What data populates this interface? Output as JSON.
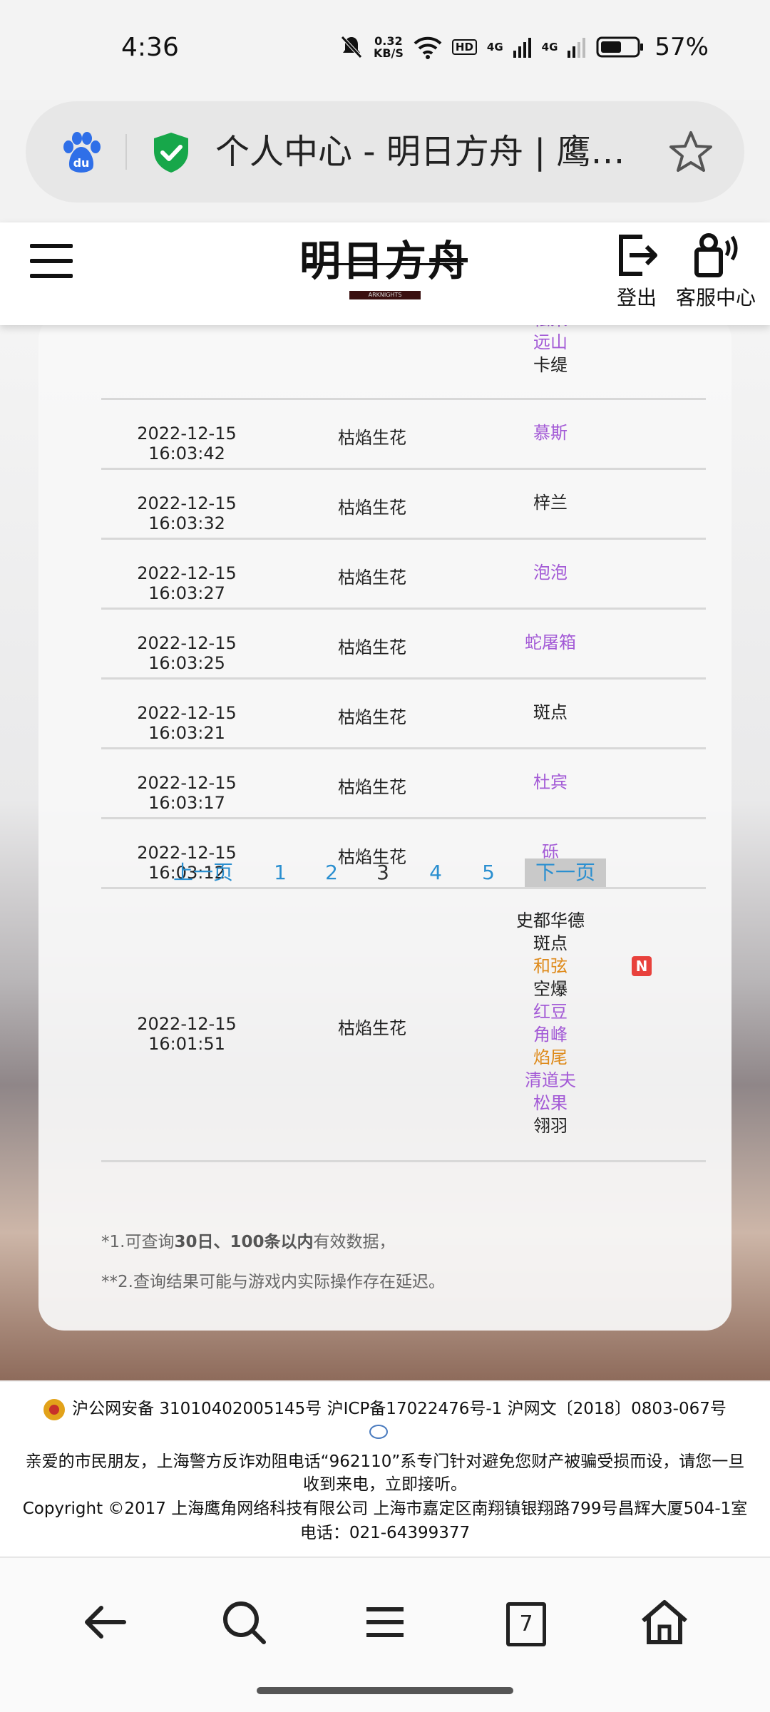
{
  "status_bar": {
    "time": "4:36",
    "net_speed_value": "0.32",
    "net_speed_unit": "KB/S",
    "hd_label": "HD",
    "sig1": "4G",
    "sig2": "4G",
    "battery": "57%"
  },
  "browser": {
    "page_title": "个人中心 - 明日方舟 | 鹰…"
  },
  "site_header": {
    "logo_text": "明日方舟",
    "logo_sub": "ARKNIGHTS",
    "logout_label": "登出",
    "service_label": "客服中心"
  },
  "records": [
    {
      "time": "",
      "item": "",
      "operators": [
        {
          "name": "松果",
          "color": "purple"
        },
        {
          "name": "远山",
          "color": "purple"
        },
        {
          "name": "卡缇",
          "color": "black"
        }
      ]
    },
    {
      "time": "2022-12-15 16:03:42",
      "item": "枯焰生花",
      "operators": [
        {
          "name": "慕斯",
          "color": "purple"
        }
      ]
    },
    {
      "time": "2022-12-15 16:03:32",
      "item": "枯焰生花",
      "operators": [
        {
          "name": "梓兰",
          "color": "black"
        }
      ]
    },
    {
      "time": "2022-12-15 16:03:27",
      "item": "枯焰生花",
      "operators": [
        {
          "name": "泡泡",
          "color": "purple"
        }
      ]
    },
    {
      "time": "2022-12-15 16:03:25",
      "item": "枯焰生花",
      "operators": [
        {
          "name": "蛇屠箱",
          "color": "purple"
        }
      ]
    },
    {
      "time": "2022-12-15 16:03:21",
      "item": "枯焰生花",
      "operators": [
        {
          "name": "斑点",
          "color": "black"
        }
      ]
    },
    {
      "time": "2022-12-15 16:03:17",
      "item": "枯焰生花",
      "operators": [
        {
          "name": "杜宾",
          "color": "purple"
        }
      ]
    },
    {
      "time": "2022-12-15 16:03:12",
      "item": "枯焰生花",
      "operators": [
        {
          "name": "砾",
          "color": "purple"
        }
      ]
    },
    {
      "time": "2022-12-15 16:01:51",
      "item": "枯焰生花",
      "new_badge": "N",
      "operators": [
        {
          "name": "史都华德",
          "color": "black"
        },
        {
          "name": "斑点",
          "color": "black"
        },
        {
          "name": "和弦",
          "color": "orange"
        },
        {
          "name": "空爆",
          "color": "black"
        },
        {
          "name": "红豆",
          "color": "purple"
        },
        {
          "name": "角峰",
          "color": "purple"
        },
        {
          "name": "焰尾",
          "color": "orange"
        },
        {
          "name": "清道夫",
          "color": "purple"
        },
        {
          "name": "松果",
          "color": "purple"
        },
        {
          "name": "翎羽",
          "color": "black"
        }
      ]
    }
  ],
  "pagination": {
    "prev": "上一页",
    "pages": [
      "1",
      "2",
      "3",
      "4",
      "5"
    ],
    "current_page": "3",
    "next": "下一页"
  },
  "notes": {
    "note1_pre": "*1.可查询",
    "note1_bold": "30日、100条以内",
    "note1_post": "有效数据，",
    "note2": "**2.查询结果可能与游戏内实际操作存在延迟。"
  },
  "footer": {
    "icp_line": "沪公网安备 31010402005145号 沪ICP备17022476号-1 沪网文〔2018〕0803-067号",
    "police_line1": "亲爱的市民朋友，上海警方反诈劝阻电话“962110”系专门针对避免您财产被骗受损而设，请您一旦",
    "police_line2": "收到来电，立即接听。",
    "copyright": "Copyright ©2017 上海鹰角网络科技有限公司 上海市嘉定区南翔镇银翔路799号昌辉大厦504-1室",
    "phone": "电话：021-64399377"
  },
  "bottom_nav": {
    "tab_count": "7"
  },
  "colors": {
    "rarity_purple": "#a35ad6",
    "rarity_orange": "#de8a1a",
    "link_blue": "#2a8fd0",
    "new_badge_red": "#e8413c"
  }
}
